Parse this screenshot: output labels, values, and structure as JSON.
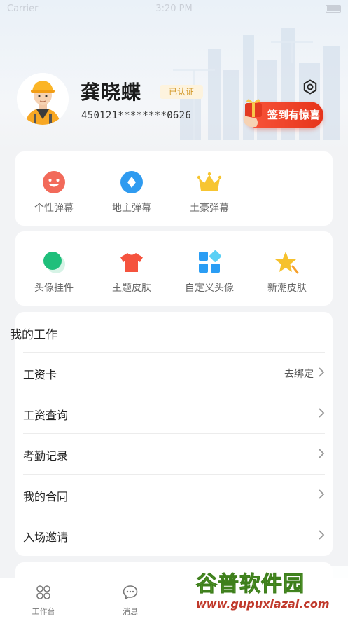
{
  "status_bar": {
    "carrier": "Carrier",
    "time": "3:20 PM"
  },
  "profile": {
    "name": "龚晓蝶",
    "verified_label": "已认证",
    "id_number": "450121********0626",
    "checkin_label": "签到有惊喜"
  },
  "barrage": {
    "items": [
      {
        "label": "个性弹幕",
        "icon": "smiley-face-icon",
        "color": "#f26a5a"
      },
      {
        "label": "地主弹幕",
        "icon": "diamond-icon",
        "color": "#2f9bf0"
      },
      {
        "label": "土豪弹幕",
        "icon": "crown-icon",
        "color": "#f7c531"
      }
    ]
  },
  "skins": {
    "items": [
      {
        "label": "头像挂件",
        "icon": "pendant-icon",
        "color": "#1fbf7b"
      },
      {
        "label": "主题皮肤",
        "icon": "tshirt-icon",
        "color": "#f5533e"
      },
      {
        "label": "自定义头像",
        "icon": "grid-avatar-icon",
        "color": "#2a9df4"
      },
      {
        "label": "新潮皮肤",
        "icon": "star-icon",
        "color": "#f6c12c"
      }
    ]
  },
  "work": {
    "title": "我的工作",
    "rows": [
      {
        "label": "工资卡",
        "value": "去绑定"
      },
      {
        "label": "工资查询",
        "value": ""
      },
      {
        "label": "考勤记录",
        "value": ""
      },
      {
        "label": "我的合同",
        "value": ""
      },
      {
        "label": "入场邀请",
        "value": ""
      }
    ]
  },
  "tab_bar": {
    "tabs": [
      {
        "label": "工作台",
        "icon": "workbench-icon"
      },
      {
        "label": "消息",
        "icon": "message-icon"
      }
    ]
  },
  "watermark": {
    "title": "谷普软件园",
    "url": "www.gupuxiazai.com"
  },
  "colors": {
    "accent": "#e6341b",
    "badge_bg": "#fdf3de",
    "badge_text": "#d39a2b"
  }
}
